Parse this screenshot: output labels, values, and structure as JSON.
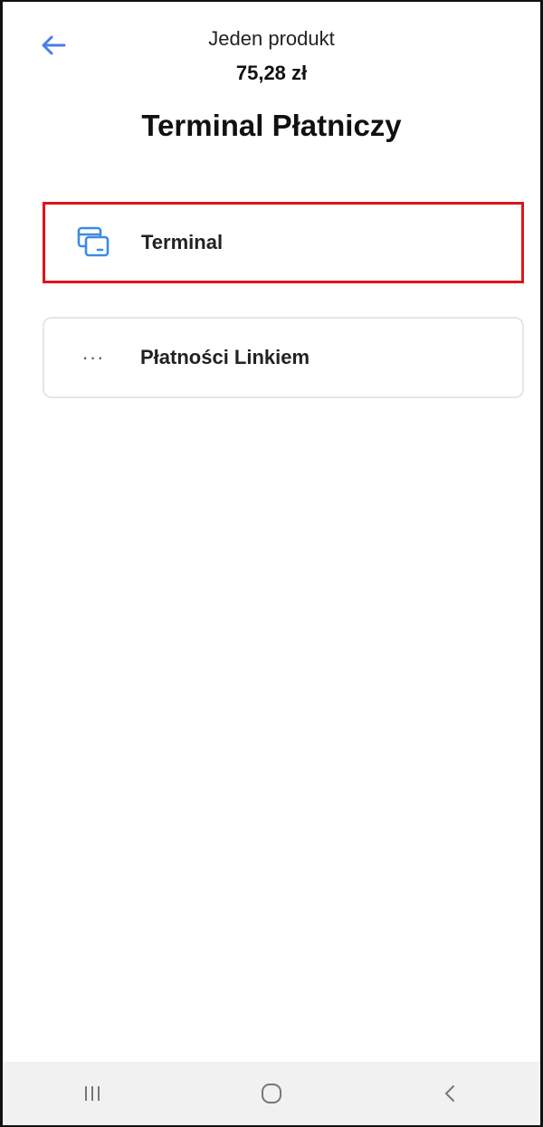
{
  "header": {
    "back_icon": "arrow-left-icon",
    "subtitle": "Jeden produkt",
    "price": "75,28 zł",
    "title": "Terminal Płatniczy"
  },
  "options": [
    {
      "label": "Terminal",
      "icon": "card-terminal-icon",
      "selected": true
    },
    {
      "label": "Płatności Linkiem",
      "icon": "more-dots-icon",
      "dots": "···",
      "selected": false
    }
  ],
  "navbar": {
    "recents_icon": "recent-apps-icon",
    "home_icon": "home-icon",
    "back_icon": "back-chevron-icon"
  },
  "colors": {
    "accent": "#4a7de8",
    "icon_blue": "#3b8be5",
    "selection_border": "#e0141c",
    "nav_background": "#f1f1f1"
  }
}
